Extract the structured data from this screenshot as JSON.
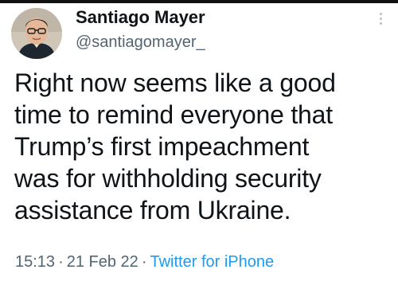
{
  "author": {
    "display_name": "Santiago Mayer",
    "handle": "@santiagomayer_",
    "avatar_icon": "person-avatar-icon"
  },
  "tweet": {
    "lines": [
      "Right now seems like a good",
      "time to remind everyone that",
      "Trump’s first impeachment",
      "was for withholding security",
      "assistance from Ukraine."
    ]
  },
  "meta": {
    "time": "15:13",
    "separator": "·",
    "date": "21 Feb 22",
    "source": "Twitter for iPhone"
  },
  "colors": {
    "text": "#0f1419",
    "secondary": "#536471",
    "link": "#1d9bf0"
  }
}
